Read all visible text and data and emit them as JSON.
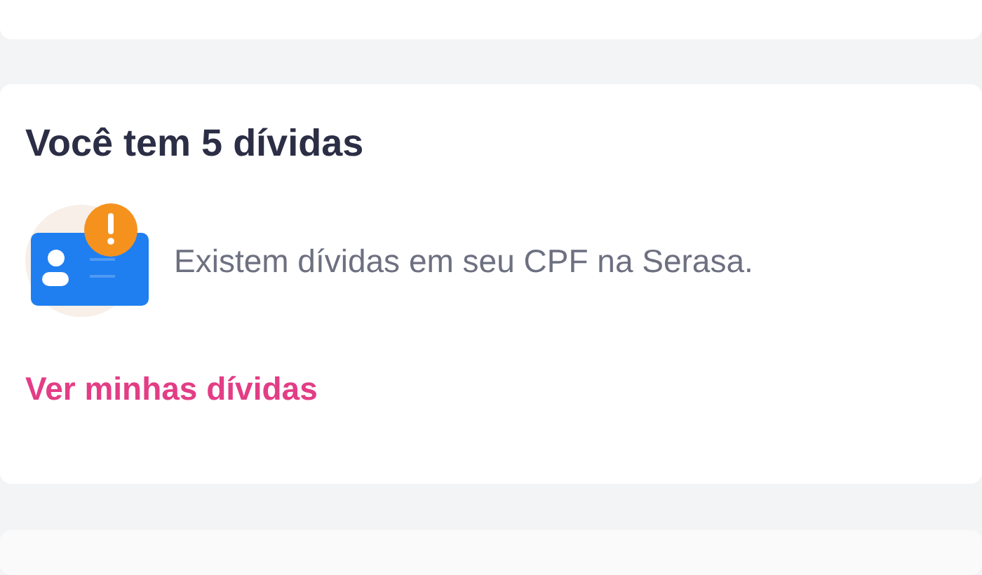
{
  "card": {
    "title": "Você tem 5 dívidas",
    "message": "Existem dívidas em seu CPF na Serasa.",
    "link": "Ver minhas dívidas"
  }
}
